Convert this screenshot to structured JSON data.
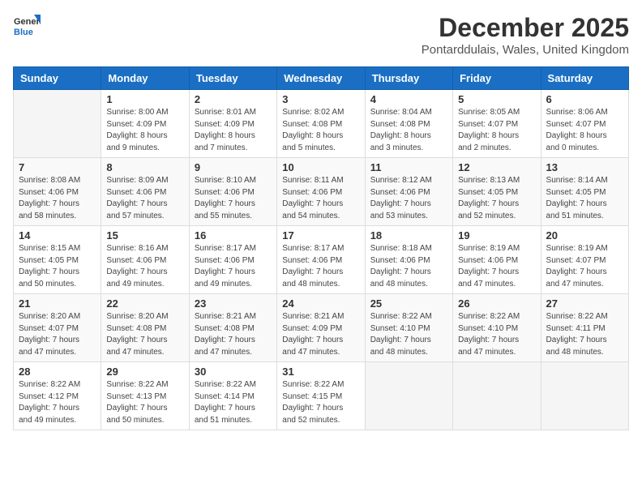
{
  "logo": {
    "line1": "General",
    "line2": "Blue"
  },
  "title": "December 2025",
  "location": "Pontarddulais, Wales, United Kingdom",
  "weekdays": [
    "Sunday",
    "Monday",
    "Tuesday",
    "Wednesday",
    "Thursday",
    "Friday",
    "Saturday"
  ],
  "weeks": [
    [
      {
        "day": "",
        "sunrise": "",
        "sunset": "",
        "daylight": ""
      },
      {
        "day": "1",
        "sunrise": "Sunrise: 8:00 AM",
        "sunset": "Sunset: 4:09 PM",
        "daylight": "Daylight: 8 hours and 9 minutes."
      },
      {
        "day": "2",
        "sunrise": "Sunrise: 8:01 AM",
        "sunset": "Sunset: 4:09 PM",
        "daylight": "Daylight: 8 hours and 7 minutes."
      },
      {
        "day": "3",
        "sunrise": "Sunrise: 8:02 AM",
        "sunset": "Sunset: 4:08 PM",
        "daylight": "Daylight: 8 hours and 5 minutes."
      },
      {
        "day": "4",
        "sunrise": "Sunrise: 8:04 AM",
        "sunset": "Sunset: 4:08 PM",
        "daylight": "Daylight: 8 hours and 3 minutes."
      },
      {
        "day": "5",
        "sunrise": "Sunrise: 8:05 AM",
        "sunset": "Sunset: 4:07 PM",
        "daylight": "Daylight: 8 hours and 2 minutes."
      },
      {
        "day": "6",
        "sunrise": "Sunrise: 8:06 AM",
        "sunset": "Sunset: 4:07 PM",
        "daylight": "Daylight: 8 hours and 0 minutes."
      }
    ],
    [
      {
        "day": "7",
        "sunrise": "Sunrise: 8:08 AM",
        "sunset": "Sunset: 4:06 PM",
        "daylight": "Daylight: 7 hours and 58 minutes."
      },
      {
        "day": "8",
        "sunrise": "Sunrise: 8:09 AM",
        "sunset": "Sunset: 4:06 PM",
        "daylight": "Daylight: 7 hours and 57 minutes."
      },
      {
        "day": "9",
        "sunrise": "Sunrise: 8:10 AM",
        "sunset": "Sunset: 4:06 PM",
        "daylight": "Daylight: 7 hours and 55 minutes."
      },
      {
        "day": "10",
        "sunrise": "Sunrise: 8:11 AM",
        "sunset": "Sunset: 4:06 PM",
        "daylight": "Daylight: 7 hours and 54 minutes."
      },
      {
        "day": "11",
        "sunrise": "Sunrise: 8:12 AM",
        "sunset": "Sunset: 4:06 PM",
        "daylight": "Daylight: 7 hours and 53 minutes."
      },
      {
        "day": "12",
        "sunrise": "Sunrise: 8:13 AM",
        "sunset": "Sunset: 4:05 PM",
        "daylight": "Daylight: 7 hours and 52 minutes."
      },
      {
        "day": "13",
        "sunrise": "Sunrise: 8:14 AM",
        "sunset": "Sunset: 4:05 PM",
        "daylight": "Daylight: 7 hours and 51 minutes."
      }
    ],
    [
      {
        "day": "14",
        "sunrise": "Sunrise: 8:15 AM",
        "sunset": "Sunset: 4:05 PM",
        "daylight": "Daylight: 7 hours and 50 minutes."
      },
      {
        "day": "15",
        "sunrise": "Sunrise: 8:16 AM",
        "sunset": "Sunset: 4:06 PM",
        "daylight": "Daylight: 7 hours and 49 minutes."
      },
      {
        "day": "16",
        "sunrise": "Sunrise: 8:17 AM",
        "sunset": "Sunset: 4:06 PM",
        "daylight": "Daylight: 7 hours and 49 minutes."
      },
      {
        "day": "17",
        "sunrise": "Sunrise: 8:17 AM",
        "sunset": "Sunset: 4:06 PM",
        "daylight": "Daylight: 7 hours and 48 minutes."
      },
      {
        "day": "18",
        "sunrise": "Sunrise: 8:18 AM",
        "sunset": "Sunset: 4:06 PM",
        "daylight": "Daylight: 7 hours and 48 minutes."
      },
      {
        "day": "19",
        "sunrise": "Sunrise: 8:19 AM",
        "sunset": "Sunset: 4:06 PM",
        "daylight": "Daylight: 7 hours and 47 minutes."
      },
      {
        "day": "20",
        "sunrise": "Sunrise: 8:19 AM",
        "sunset": "Sunset: 4:07 PM",
        "daylight": "Daylight: 7 hours and 47 minutes."
      }
    ],
    [
      {
        "day": "21",
        "sunrise": "Sunrise: 8:20 AM",
        "sunset": "Sunset: 4:07 PM",
        "daylight": "Daylight: 7 hours and 47 minutes."
      },
      {
        "day": "22",
        "sunrise": "Sunrise: 8:20 AM",
        "sunset": "Sunset: 4:08 PM",
        "daylight": "Daylight: 7 hours and 47 minutes."
      },
      {
        "day": "23",
        "sunrise": "Sunrise: 8:21 AM",
        "sunset": "Sunset: 4:08 PM",
        "daylight": "Daylight: 7 hours and 47 minutes."
      },
      {
        "day": "24",
        "sunrise": "Sunrise: 8:21 AM",
        "sunset": "Sunset: 4:09 PM",
        "daylight": "Daylight: 7 hours and 47 minutes."
      },
      {
        "day": "25",
        "sunrise": "Sunrise: 8:22 AM",
        "sunset": "Sunset: 4:10 PM",
        "daylight": "Daylight: 7 hours and 48 minutes."
      },
      {
        "day": "26",
        "sunrise": "Sunrise: 8:22 AM",
        "sunset": "Sunset: 4:10 PM",
        "daylight": "Daylight: 7 hours and 47 minutes."
      },
      {
        "day": "27",
        "sunrise": "Sunrise: 8:22 AM",
        "sunset": "Sunset: 4:11 PM",
        "daylight": "Daylight: 7 hours and 48 minutes."
      }
    ],
    [
      {
        "day": "28",
        "sunrise": "Sunrise: 8:22 AM",
        "sunset": "Sunset: 4:12 PM",
        "daylight": "Daylight: 7 hours and 49 minutes."
      },
      {
        "day": "29",
        "sunrise": "Sunrise: 8:22 AM",
        "sunset": "Sunset: 4:13 PM",
        "daylight": "Daylight: 7 hours and 50 minutes."
      },
      {
        "day": "30",
        "sunrise": "Sunrise: 8:22 AM",
        "sunset": "Sunset: 4:14 PM",
        "daylight": "Daylight: 7 hours and 51 minutes."
      },
      {
        "day": "31",
        "sunrise": "Sunrise: 8:22 AM",
        "sunset": "Sunset: 4:15 PM",
        "daylight": "Daylight: 7 hours and 52 minutes."
      },
      {
        "day": "",
        "sunrise": "",
        "sunset": "",
        "daylight": ""
      },
      {
        "day": "",
        "sunrise": "",
        "sunset": "",
        "daylight": ""
      },
      {
        "day": "",
        "sunrise": "",
        "sunset": "",
        "daylight": ""
      }
    ]
  ]
}
